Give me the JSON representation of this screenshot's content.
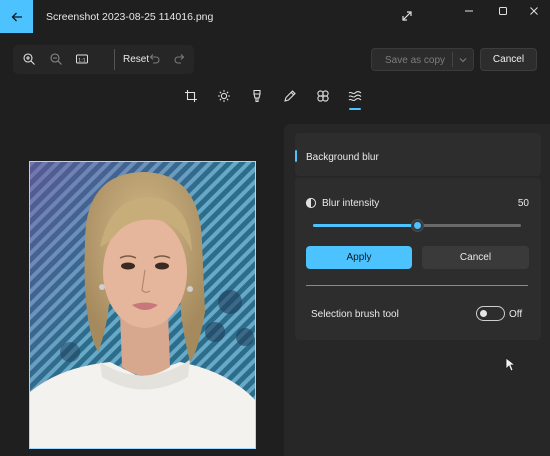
{
  "window": {
    "title": "Screenshot 2023-08-25 114016.png"
  },
  "toolbar": {
    "reset_label": "Reset",
    "save_as_copy_label": "Save as copy",
    "cancel_label": "Cancel"
  },
  "edit_tools": [
    "crop",
    "adjustment",
    "filter",
    "markup",
    "erase",
    "background"
  ],
  "panel": {
    "section_title": "Background blur",
    "blur_intensity_label": "Blur intensity",
    "blur_intensity_value": "50",
    "blur_intensity_fraction": 0.5,
    "apply_label": "Apply",
    "cancel_label": "Cancel",
    "selection_brush_label": "Selection brush tool",
    "selection_brush_state": "Off"
  },
  "colors": {
    "accent": "#4cc2ff",
    "background": "#1f1f1f",
    "panel": "#272727"
  }
}
